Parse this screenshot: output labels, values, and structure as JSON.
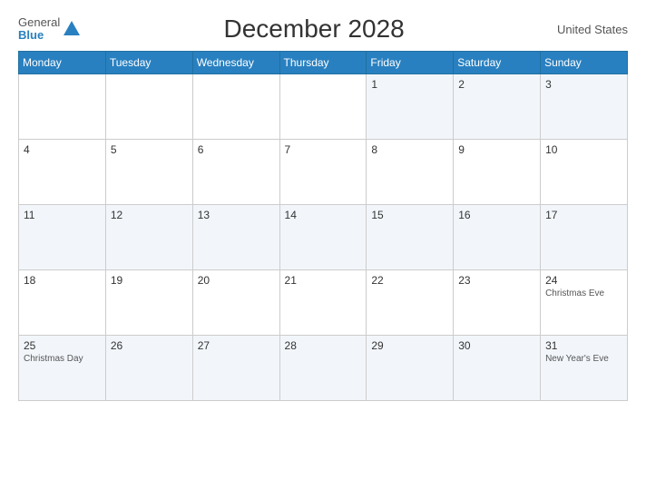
{
  "header": {
    "logo_general": "General",
    "logo_blue": "Blue",
    "title": "December 2028",
    "country": "United States"
  },
  "days_of_week": [
    "Monday",
    "Tuesday",
    "Wednesday",
    "Thursday",
    "Friday",
    "Saturday",
    "Sunday"
  ],
  "weeks": [
    [
      {
        "day": "",
        "event": ""
      },
      {
        "day": "",
        "event": ""
      },
      {
        "day": "",
        "event": ""
      },
      {
        "day": "",
        "event": ""
      },
      {
        "day": "1",
        "event": ""
      },
      {
        "day": "2",
        "event": ""
      },
      {
        "day": "3",
        "event": ""
      }
    ],
    [
      {
        "day": "4",
        "event": ""
      },
      {
        "day": "5",
        "event": ""
      },
      {
        "day": "6",
        "event": ""
      },
      {
        "day": "7",
        "event": ""
      },
      {
        "day": "8",
        "event": ""
      },
      {
        "day": "9",
        "event": ""
      },
      {
        "day": "10",
        "event": ""
      }
    ],
    [
      {
        "day": "11",
        "event": ""
      },
      {
        "day": "12",
        "event": ""
      },
      {
        "day": "13",
        "event": ""
      },
      {
        "day": "14",
        "event": ""
      },
      {
        "day": "15",
        "event": ""
      },
      {
        "day": "16",
        "event": ""
      },
      {
        "day": "17",
        "event": ""
      }
    ],
    [
      {
        "day": "18",
        "event": ""
      },
      {
        "day": "19",
        "event": ""
      },
      {
        "day": "20",
        "event": ""
      },
      {
        "day": "21",
        "event": ""
      },
      {
        "day": "22",
        "event": ""
      },
      {
        "day": "23",
        "event": ""
      },
      {
        "day": "24",
        "event": "Christmas Eve"
      }
    ],
    [
      {
        "day": "25",
        "event": "Christmas Day"
      },
      {
        "day": "26",
        "event": ""
      },
      {
        "day": "27",
        "event": ""
      },
      {
        "day": "28",
        "event": ""
      },
      {
        "day": "29",
        "event": ""
      },
      {
        "day": "30",
        "event": ""
      },
      {
        "day": "31",
        "event": "New Year's Eve"
      }
    ]
  ]
}
